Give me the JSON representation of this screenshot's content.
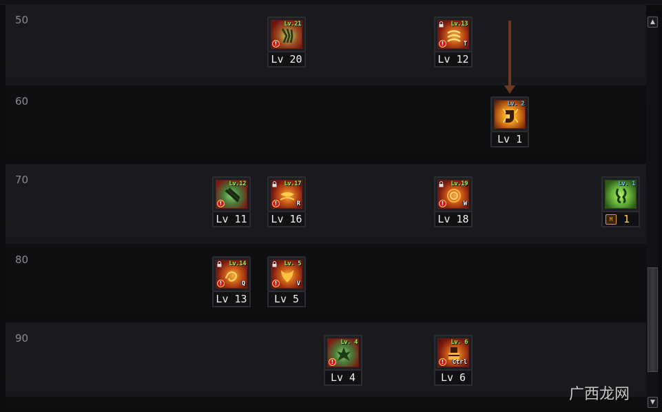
{
  "rows": [
    {
      "label": "50"
    },
    {
      "label": "60"
    },
    {
      "label": "70"
    },
    {
      "label": "80"
    },
    {
      "label": "90"
    }
  ],
  "skills": [
    {
      "badge": "Lv.21",
      "level": "Lv 20",
      "hotkey": ""
    },
    {
      "badge": "Lv.13",
      "level": "Lv 12",
      "hotkey": "T"
    },
    {
      "badge": "Lv. 2",
      "level": "Lv 1",
      "hotkey": ""
    },
    {
      "badge": "Lv.12",
      "level": "Lv 11",
      "hotkey": ""
    },
    {
      "badge": "Lv.17",
      "level": "Lv 16",
      "hotkey": "R"
    },
    {
      "badge": "Lv.19",
      "level": "Lv 18",
      "hotkey": "W"
    },
    {
      "badge": "Lv. 1",
      "level": "1",
      "hotkey": "",
      "m_label": "M"
    },
    {
      "badge": "Lv.14",
      "level": "Lv 13",
      "hotkey": "Q"
    },
    {
      "badge": "Lv. 5",
      "level": "Lv 5",
      "hotkey": "V"
    },
    {
      "badge": "Lv. 4",
      "level": "Lv 4",
      "hotkey": ""
    },
    {
      "badge": "Lv. 6",
      "level": "Lv 6",
      "hotkey": "Ctrl"
    }
  ],
  "warn_mark": "!",
  "scrollbar": {
    "up": "▲",
    "down": "▼"
  },
  "watermark": "广西龙网",
  "colors": {
    "accent_green": "#9aff4a",
    "accent_blue": "#6ad0ff",
    "arrow": "#6a3a22"
  }
}
